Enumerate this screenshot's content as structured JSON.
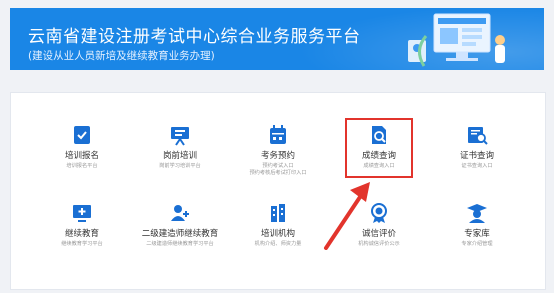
{
  "banner": {
    "title": "云南省建设注册考试中心综合业务服务平台",
    "subtitle": "(建设从业人员新培及继续教育业务办理)"
  },
  "tiles": [
    {
      "title": "培训报名",
      "desc": "培训报名平台"
    },
    {
      "title": "岗前培训",
      "desc": "岗前学习培训平台"
    },
    {
      "title": "考务预约",
      "desc": "预约考试入口",
      "desc2": "预约考核后考试打印入口"
    },
    {
      "title": "成绩查询",
      "desc": "成绩查询入口"
    },
    {
      "title": "证书查询",
      "desc": "证书查询入口"
    },
    {
      "title": "继续教育",
      "desc": "继续教育学习平台"
    },
    {
      "title": "二级建造师继续教育",
      "desc": "二级建造师继续教育学习平台"
    },
    {
      "title": "培训机构",
      "desc": "机构介绍、师资力量"
    },
    {
      "title": "诚信评价",
      "desc": "机构诚信评价公示"
    },
    {
      "title": "专家库",
      "desc": "专家介绍管理"
    }
  ],
  "colors": {
    "banner": "#1a86e6",
    "icon": "#1a6fd3",
    "highlight": "#e2342c"
  }
}
